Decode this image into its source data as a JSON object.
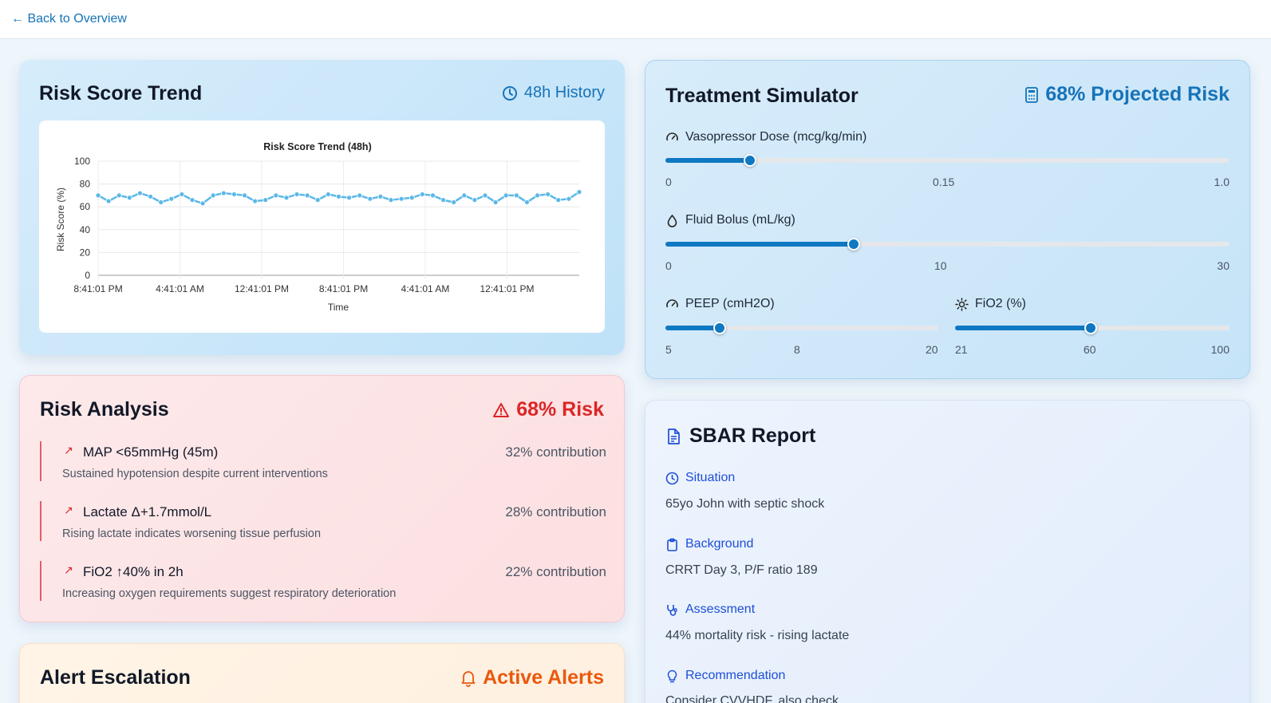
{
  "nav": {
    "back_label": "← Back to Overview"
  },
  "trend": {
    "title": "Risk Score Trend",
    "badge": "48h History",
    "badge_icon": "clock-icon"
  },
  "chart_data": {
    "type": "line",
    "title": "Risk Score Trend (48h)",
    "xlabel": "Time",
    "ylabel": "Risk Score (%)",
    "ylim": [
      0,
      100
    ],
    "yticks": [
      "0",
      "20",
      "40",
      "60",
      "80",
      "100"
    ],
    "xticks": [
      "8:41:01 PM",
      "4:41:01 AM",
      "12:41:01 PM",
      "8:41:01 PM",
      "4:41:01 AM",
      "12:41:01 PM"
    ],
    "grid": true,
    "color": "#5bb8e8",
    "series": [
      {
        "values": [
          70,
          65,
          70,
          68,
          72,
          69,
          64,
          67,
          71,
          66,
          63,
          70,
          72,
          71,
          70,
          65,
          66,
          70,
          68,
          71,
          70,
          66,
          71,
          69,
          68,
          70,
          67,
          69,
          66,
          67,
          68,
          71,
          70,
          66,
          64,
          70,
          66,
          70,
          64,
          70,
          70,
          64,
          70,
          71,
          66,
          67,
          73
        ]
      }
    ]
  },
  "analysis": {
    "title": "Risk Analysis",
    "badge": "68% Risk",
    "badge_icon": "warning-icon",
    "factors": [
      {
        "name": "MAP <65mmHg (45m)",
        "desc": "Sustained hypotension despite current interventions",
        "contrib": "32% contribution"
      },
      {
        "name": "Lactate Δ+1.7mmol/L",
        "desc": "Rising lactate indicates worsening tissue perfusion",
        "contrib": "28% contribution"
      },
      {
        "name": "FiO2 ↑40% in 2h",
        "desc": "Increasing oxygen requirements suggest respiratory deterioration",
        "contrib": "22% contribution"
      }
    ],
    "arrow_icon": "trend-up-icon",
    "accent": "#dc2626"
  },
  "alerts": {
    "title": "Alert Escalation",
    "badge": "Active Alerts",
    "badge_icon": "bell-icon",
    "accent": "#ea580c"
  },
  "simulator": {
    "title": "Treatment Simulator",
    "badge": "68% Projected Risk",
    "badge_icon": "calculator-icon",
    "vaso": {
      "label": "Vasopressor Dose (mcg/kg/min)",
      "min": "0",
      "mid": "0.15",
      "max": "1.0",
      "value": 0.15
    },
    "fluid": {
      "label": "Fluid Bolus (mL/kg)",
      "min": "0",
      "mid": "10",
      "max": "30",
      "value": 10
    },
    "peep": {
      "label": "PEEP (cmH2O)",
      "min": "5",
      "mid": "8",
      "max": "20",
      "value": 8
    },
    "fio2": {
      "label": "FiO2 (%)",
      "min": "21",
      "mid": "60",
      "max": "100",
      "value": 60
    },
    "accent": "#0e78c2"
  },
  "sbar": {
    "title": "SBAR Report",
    "situation_label": "Situation",
    "situation": "65yo John with septic shock",
    "background_label": "Background",
    "background": "CRRT Day 3, P/F ratio 189",
    "assessment_label": "Assessment",
    "assessment": "44% mortality risk - rising lactate",
    "recommendation_label": "Recommendation",
    "recommendation": "Consider CVVHDF, also check"
  }
}
